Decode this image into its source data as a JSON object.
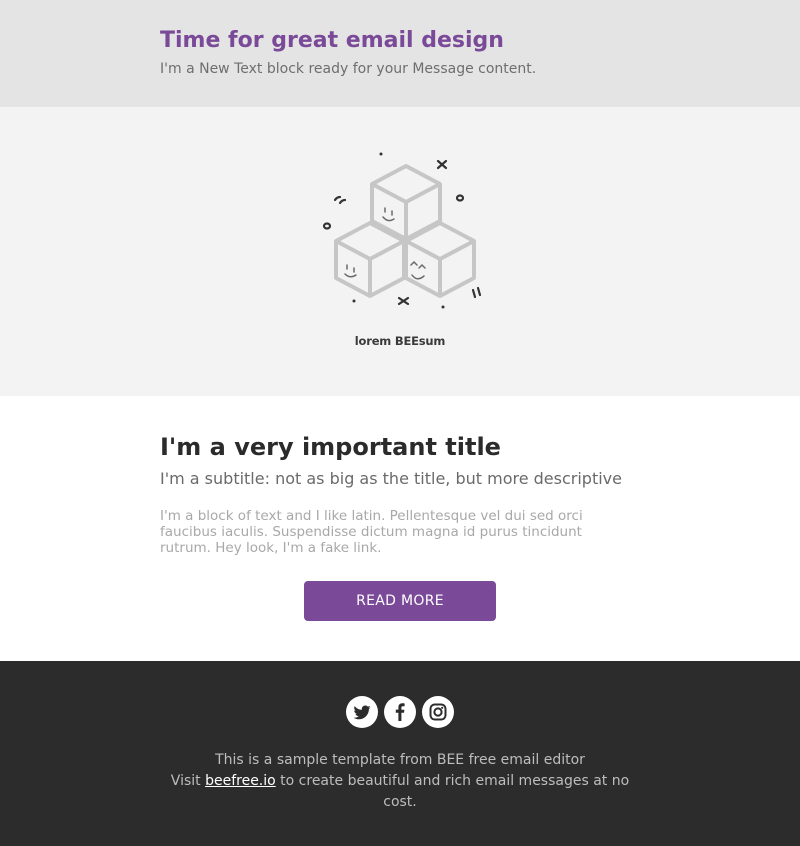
{
  "header": {
    "title": "Time for great email design",
    "text": "I'm a New Text block ready for your Message content."
  },
  "hero": {
    "logo_text": "lorem BEEsum",
    "logo_icon": "cube-stack-icon"
  },
  "content": {
    "title": "I'm a very important title",
    "subtitle": "I'm a subtitle: not as big as the title, but more descriptive",
    "body": "I'm a block of text and I like latin. Pellentesque vel dui sed orci faucibus iaculis. Suspendisse dictum magna id purus tincidunt rutrum. Hey look, I'm a fake link.",
    "button_label": "READ MORE"
  },
  "footer": {
    "social": [
      "twitter-icon",
      "facebook-icon",
      "instagram-icon"
    ],
    "line1": "This is a sample template from BEE free email editor",
    "visit": "Visit",
    "link_text": "beefree.io",
    "line2_rest": "to create beautiful and rich email messages at no cost."
  },
  "colors": {
    "accent": "#7a4a99",
    "header_bg": "#e4e4e4",
    "hero_bg": "#f3f3f3",
    "footer_bg": "#2c2c2c"
  }
}
